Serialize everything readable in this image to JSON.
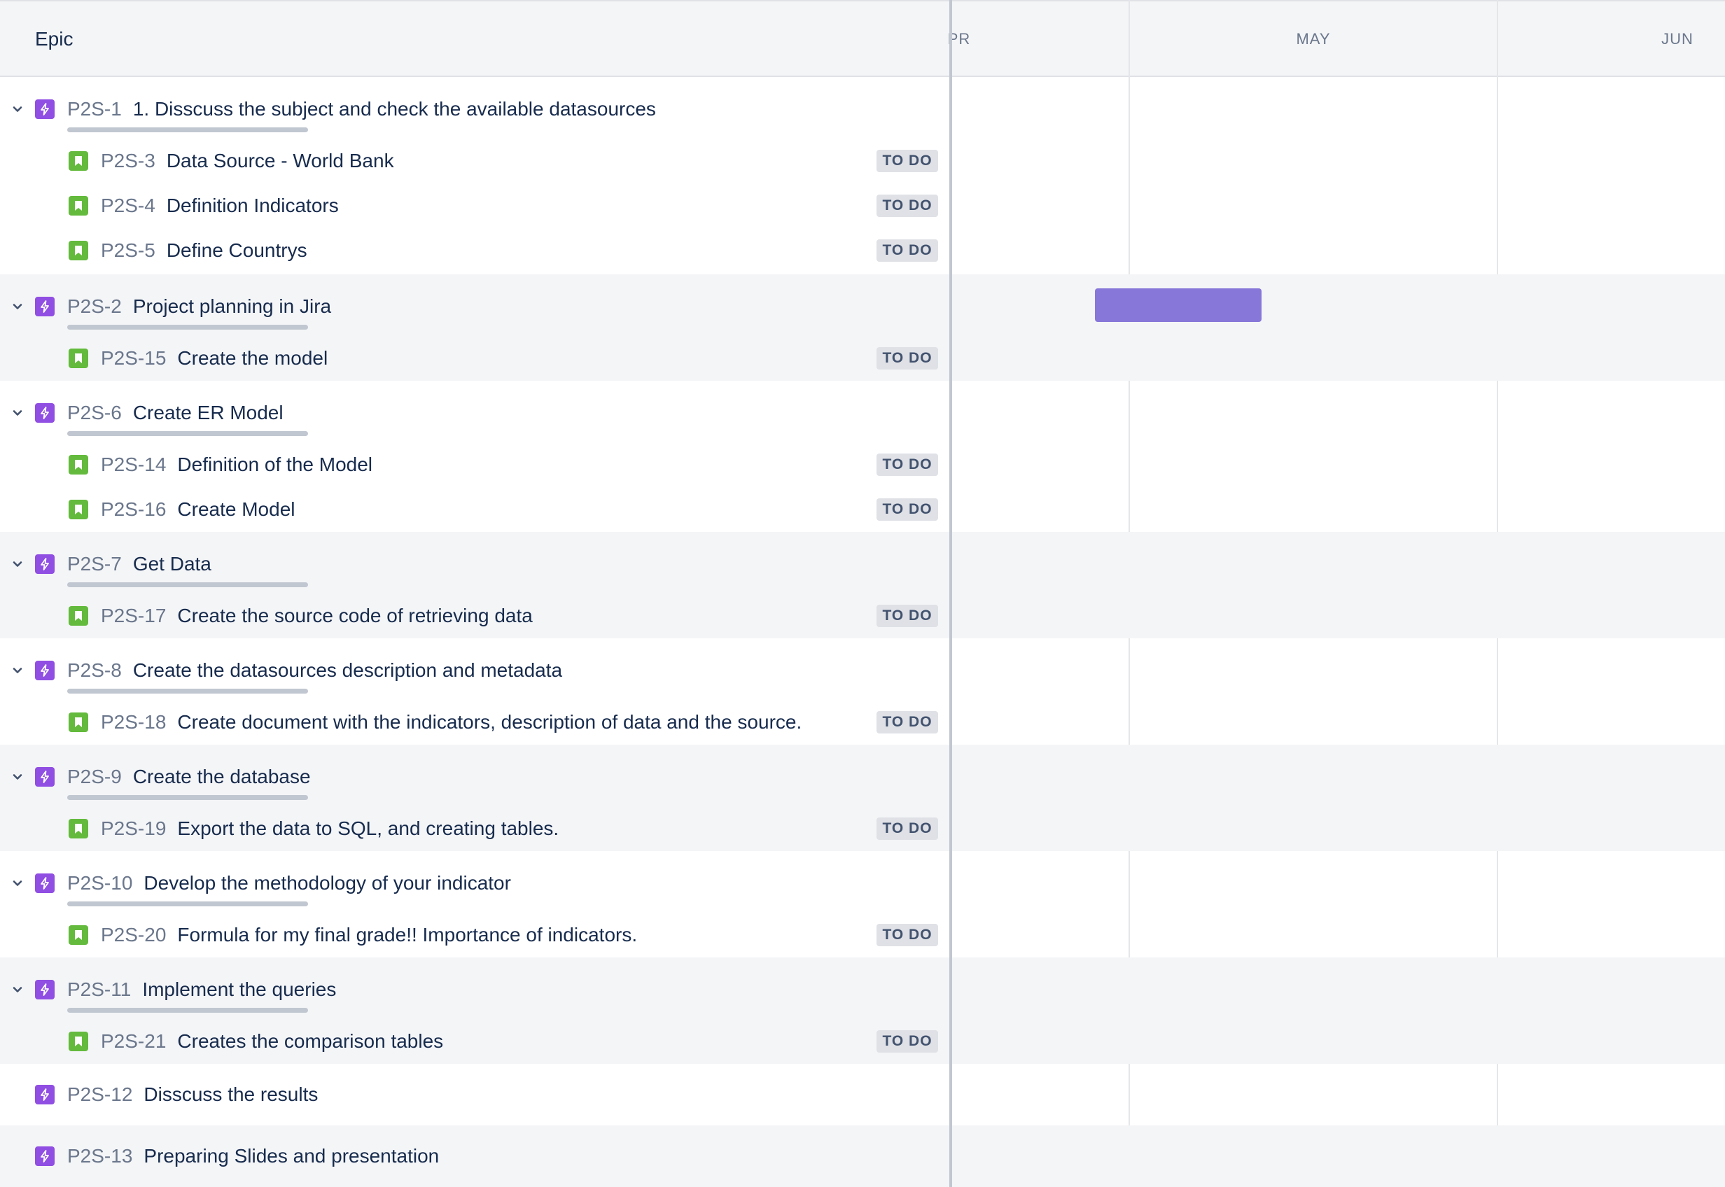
{
  "header": {
    "epic_label": "Epic",
    "months": [
      "PR",
      "MAY",
      "JUN"
    ]
  },
  "epics": [
    {
      "key": "P2S-1",
      "summary": "1. Disscuss the subject and check the available datasources",
      "children": [
        {
          "key": "P2S-3",
          "summary": "Data Source - World Bank",
          "status": "TO DO"
        },
        {
          "key": "P2S-4",
          "summary": "Definition Indicators",
          "status": "TO DO"
        },
        {
          "key": "P2S-5",
          "summary": "Define Countrys",
          "status": "TO DO"
        }
      ]
    },
    {
      "key": "P2S-2",
      "summary": "Project planning in Jira",
      "children": [
        {
          "key": "P2S-15",
          "summary": "Create the model",
          "status": "TO DO"
        }
      ]
    },
    {
      "key": "P2S-6",
      "summary": "Create ER Model",
      "children": [
        {
          "key": "P2S-14",
          "summary": "Definition of the Model",
          "status": "TO DO"
        },
        {
          "key": "P2S-16",
          "summary": "Create Model",
          "status": "TO DO"
        }
      ]
    },
    {
      "key": "P2S-7",
      "summary": "Get Data",
      "children": [
        {
          "key": "P2S-17",
          "summary": "Create the source code of retrieving data",
          "status": "TO DO"
        }
      ]
    },
    {
      "key": "P2S-8",
      "summary": "Create the datasources description and metadata",
      "children": [
        {
          "key": "P2S-18",
          "summary": "Create document with the indicators, description of data and the source.",
          "status": "TO DO"
        }
      ]
    },
    {
      "key": "P2S-9",
      "summary": "Create the database",
      "children": [
        {
          "key": "P2S-19",
          "summary": "Export the data to SQL, and creating tables.",
          "status": "TO DO"
        }
      ]
    },
    {
      "key": "P2S-10",
      "summary": "Develop the methodology of your indicator",
      "children": [
        {
          "key": "P2S-20",
          "summary": "Formula for my final grade!! Importance of indicators.",
          "status": "TO DO"
        }
      ]
    },
    {
      "key": "P2S-11",
      "summary": "Implement the queries",
      "children": [
        {
          "key": "P2S-21",
          "summary": "Creates the comparison tables",
          "status": "TO DO"
        }
      ]
    },
    {
      "key": "P2S-12",
      "summary": "Disscuss the results",
      "children": []
    },
    {
      "key": "P2S-13",
      "summary": "Preparing Slides and presentation",
      "children": []
    }
  ],
  "colors": {
    "epic_icon": "#904ee2",
    "story_icon": "#63ba3c",
    "timeline_bar": "#8777d9",
    "row_shade": "#f4f5f7"
  },
  "icons": {
    "chevron": "chevron-down-icon",
    "epic": "lightning-icon",
    "story": "bookmark-icon"
  }
}
